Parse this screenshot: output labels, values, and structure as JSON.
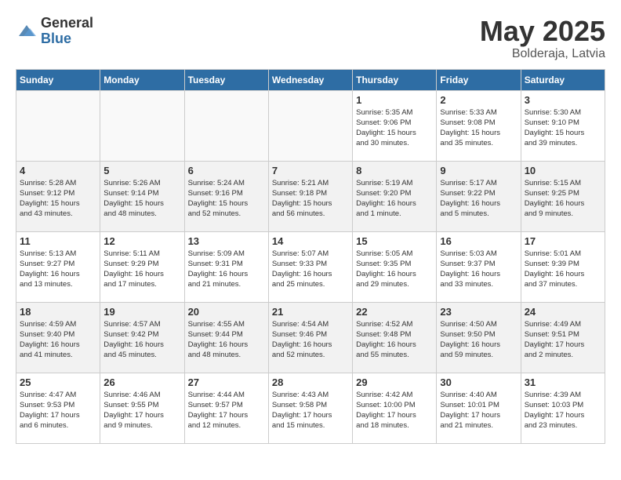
{
  "header": {
    "logo_general": "General",
    "logo_blue": "Blue",
    "month_year": "May 2025",
    "location": "Bolderaja, Latvia"
  },
  "days_of_week": [
    "Sunday",
    "Monday",
    "Tuesday",
    "Wednesday",
    "Thursday",
    "Friday",
    "Saturday"
  ],
  "weeks": [
    [
      {
        "day": "",
        "info": ""
      },
      {
        "day": "",
        "info": ""
      },
      {
        "day": "",
        "info": ""
      },
      {
        "day": "",
        "info": ""
      },
      {
        "day": "1",
        "info": "Sunrise: 5:35 AM\nSunset: 9:06 PM\nDaylight: 15 hours\nand 30 minutes."
      },
      {
        "day": "2",
        "info": "Sunrise: 5:33 AM\nSunset: 9:08 PM\nDaylight: 15 hours\nand 35 minutes."
      },
      {
        "day": "3",
        "info": "Sunrise: 5:30 AM\nSunset: 9:10 PM\nDaylight: 15 hours\nand 39 minutes."
      }
    ],
    [
      {
        "day": "4",
        "info": "Sunrise: 5:28 AM\nSunset: 9:12 PM\nDaylight: 15 hours\nand 43 minutes."
      },
      {
        "day": "5",
        "info": "Sunrise: 5:26 AM\nSunset: 9:14 PM\nDaylight: 15 hours\nand 48 minutes."
      },
      {
        "day": "6",
        "info": "Sunrise: 5:24 AM\nSunset: 9:16 PM\nDaylight: 15 hours\nand 52 minutes."
      },
      {
        "day": "7",
        "info": "Sunrise: 5:21 AM\nSunset: 9:18 PM\nDaylight: 15 hours\nand 56 minutes."
      },
      {
        "day": "8",
        "info": "Sunrise: 5:19 AM\nSunset: 9:20 PM\nDaylight: 16 hours\nand 1 minute."
      },
      {
        "day": "9",
        "info": "Sunrise: 5:17 AM\nSunset: 9:22 PM\nDaylight: 16 hours\nand 5 minutes."
      },
      {
        "day": "10",
        "info": "Sunrise: 5:15 AM\nSunset: 9:25 PM\nDaylight: 16 hours\nand 9 minutes."
      }
    ],
    [
      {
        "day": "11",
        "info": "Sunrise: 5:13 AM\nSunset: 9:27 PM\nDaylight: 16 hours\nand 13 minutes."
      },
      {
        "day": "12",
        "info": "Sunrise: 5:11 AM\nSunset: 9:29 PM\nDaylight: 16 hours\nand 17 minutes."
      },
      {
        "day": "13",
        "info": "Sunrise: 5:09 AM\nSunset: 9:31 PM\nDaylight: 16 hours\nand 21 minutes."
      },
      {
        "day": "14",
        "info": "Sunrise: 5:07 AM\nSunset: 9:33 PM\nDaylight: 16 hours\nand 25 minutes."
      },
      {
        "day": "15",
        "info": "Sunrise: 5:05 AM\nSunset: 9:35 PM\nDaylight: 16 hours\nand 29 minutes."
      },
      {
        "day": "16",
        "info": "Sunrise: 5:03 AM\nSunset: 9:37 PM\nDaylight: 16 hours\nand 33 minutes."
      },
      {
        "day": "17",
        "info": "Sunrise: 5:01 AM\nSunset: 9:39 PM\nDaylight: 16 hours\nand 37 minutes."
      }
    ],
    [
      {
        "day": "18",
        "info": "Sunrise: 4:59 AM\nSunset: 9:40 PM\nDaylight: 16 hours\nand 41 minutes."
      },
      {
        "day": "19",
        "info": "Sunrise: 4:57 AM\nSunset: 9:42 PM\nDaylight: 16 hours\nand 45 minutes."
      },
      {
        "day": "20",
        "info": "Sunrise: 4:55 AM\nSunset: 9:44 PM\nDaylight: 16 hours\nand 48 minutes."
      },
      {
        "day": "21",
        "info": "Sunrise: 4:54 AM\nSunset: 9:46 PM\nDaylight: 16 hours\nand 52 minutes."
      },
      {
        "day": "22",
        "info": "Sunrise: 4:52 AM\nSunset: 9:48 PM\nDaylight: 16 hours\nand 55 minutes."
      },
      {
        "day": "23",
        "info": "Sunrise: 4:50 AM\nSunset: 9:50 PM\nDaylight: 16 hours\nand 59 minutes."
      },
      {
        "day": "24",
        "info": "Sunrise: 4:49 AM\nSunset: 9:51 PM\nDaylight: 17 hours\nand 2 minutes."
      }
    ],
    [
      {
        "day": "25",
        "info": "Sunrise: 4:47 AM\nSunset: 9:53 PM\nDaylight: 17 hours\nand 6 minutes."
      },
      {
        "day": "26",
        "info": "Sunrise: 4:46 AM\nSunset: 9:55 PM\nDaylight: 17 hours\nand 9 minutes."
      },
      {
        "day": "27",
        "info": "Sunrise: 4:44 AM\nSunset: 9:57 PM\nDaylight: 17 hours\nand 12 minutes."
      },
      {
        "day": "28",
        "info": "Sunrise: 4:43 AM\nSunset: 9:58 PM\nDaylight: 17 hours\nand 15 minutes."
      },
      {
        "day": "29",
        "info": "Sunrise: 4:42 AM\nSunset: 10:00 PM\nDaylight: 17 hours\nand 18 minutes."
      },
      {
        "day": "30",
        "info": "Sunrise: 4:40 AM\nSunset: 10:01 PM\nDaylight: 17 hours\nand 21 minutes."
      },
      {
        "day": "31",
        "info": "Sunrise: 4:39 AM\nSunset: 10:03 PM\nDaylight: 17 hours\nand 23 minutes."
      }
    ]
  ]
}
